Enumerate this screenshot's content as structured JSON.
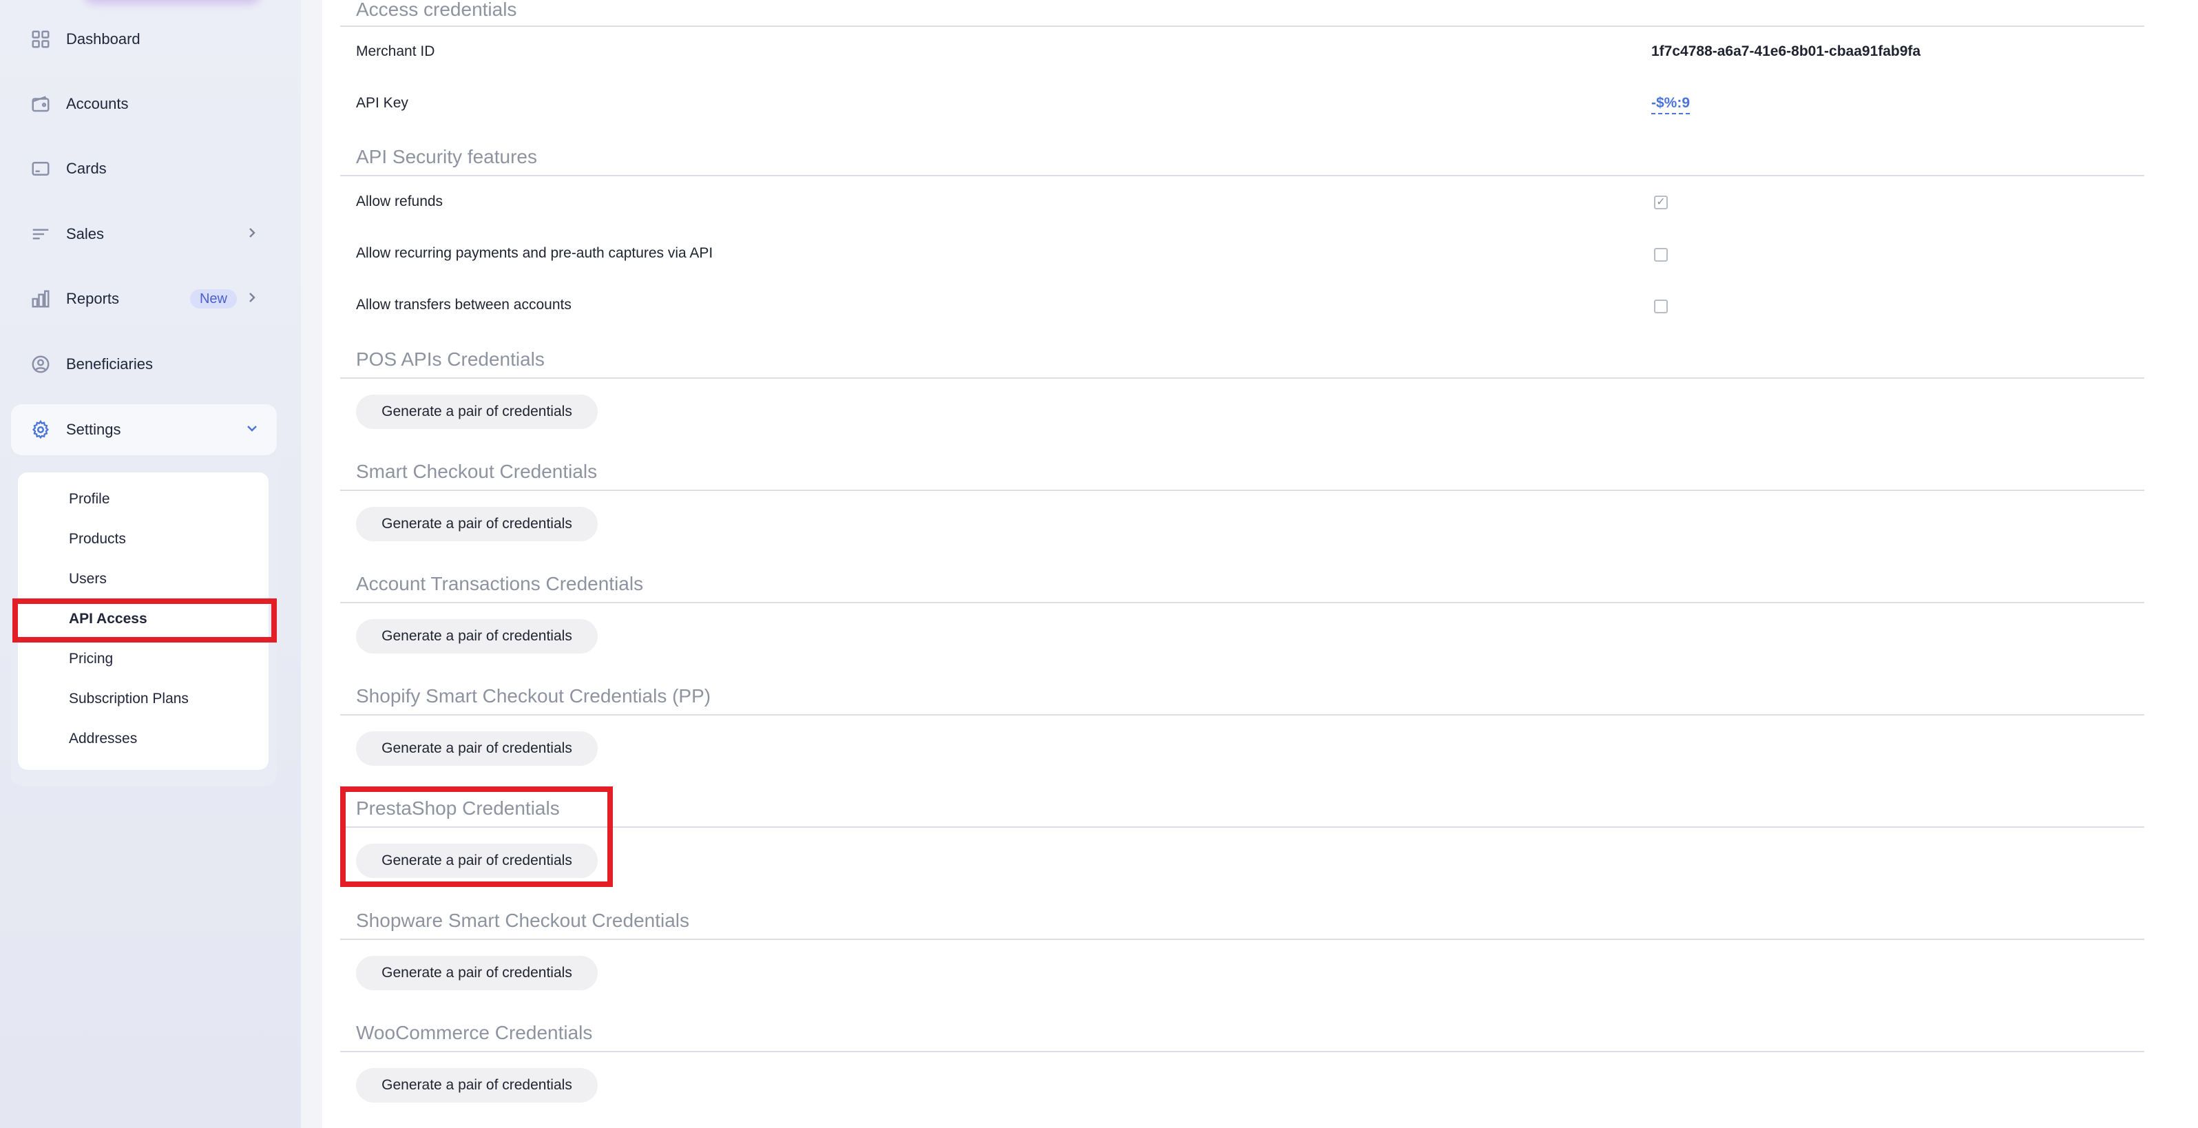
{
  "sidebar": {
    "items": [
      {
        "label": "Dashboard",
        "icon": "grid-icon"
      },
      {
        "label": "Accounts",
        "icon": "wallet-icon"
      },
      {
        "label": "Cards",
        "icon": "card-icon"
      },
      {
        "label": "Sales",
        "icon": "list-icon"
      },
      {
        "label": "Reports",
        "icon": "bar-chart-icon",
        "badge": "New"
      },
      {
        "label": "Beneficiaries",
        "icon": "user-circle-icon"
      },
      {
        "label": "Settings",
        "icon": "gear-icon"
      }
    ],
    "settings_submenu": [
      "Profile",
      "Products",
      "Users",
      "API Access",
      "Pricing",
      "Subscription Plans",
      "Addresses"
    ],
    "active_submenu": "API Access"
  },
  "main": {
    "access_credentials": {
      "title": "Access credentials",
      "merchant_id_label": "Merchant ID",
      "merchant_id_value": "1f7c4788-a6a7-41e6-8b01-cbaa91fab9fa",
      "api_key_label": "API Key",
      "api_key_value": "-$%:9"
    },
    "security": {
      "title": "API Security features",
      "features": [
        {
          "label": "Allow refunds",
          "checked": true
        },
        {
          "label": "Allow recurring payments and pre-auth captures via API",
          "checked": false
        },
        {
          "label": "Allow transfers between accounts",
          "checked": false
        }
      ]
    },
    "credential_sections": [
      {
        "title": "POS APIs Credentials",
        "button": "Generate a pair of credentials"
      },
      {
        "title": "Smart Checkout Credentials",
        "button": "Generate a pair of credentials"
      },
      {
        "title": "Account Transactions Credentials",
        "button": "Generate a pair of credentials"
      },
      {
        "title": "Shopify Smart Checkout Credentials (PP)",
        "button": "Generate a pair of credentials"
      },
      {
        "title": "PrestaShop Credentials",
        "button": "Generate a pair of credentials"
      },
      {
        "title": "Shopware Smart Checkout Credentials",
        "button": "Generate a pair of credentials"
      },
      {
        "title": "WooCommerce Credentials",
        "button": "Generate a pair of credentials"
      }
    ]
  },
  "colors": {
    "accent": "#4a74d8",
    "highlight": "#e41e26",
    "badge_bg": "#d9dffb"
  }
}
